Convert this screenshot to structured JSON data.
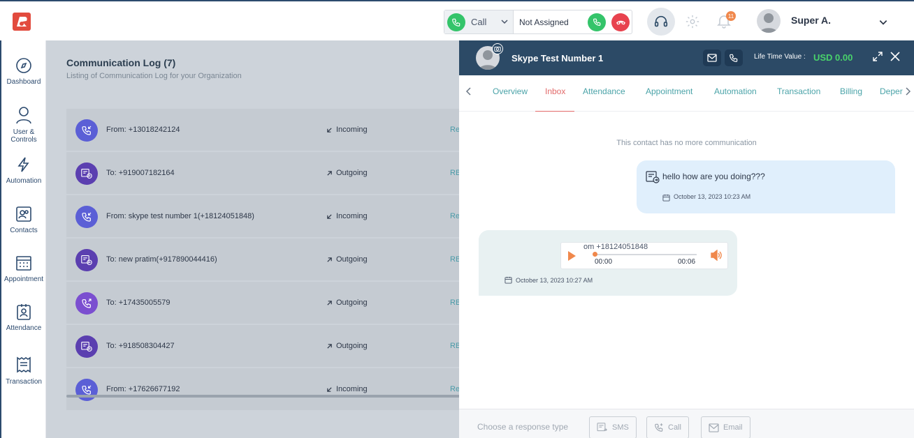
{
  "topbar": {
    "call_select": "Call",
    "agent_status": "Not Assigned",
    "notifications_count": "11",
    "user_name": "Super A."
  },
  "sidebar": {
    "items": [
      {
        "label": "Dashboard",
        "icon": "compass-icon"
      },
      {
        "label": "User &",
        "label2": "Controls",
        "icon": "user-icon"
      },
      {
        "label": "Automation",
        "icon": "lightning-icon"
      },
      {
        "label": "Contacts",
        "icon": "contacts-icon"
      },
      {
        "label": "Appointment",
        "icon": "calendar-grid-icon"
      },
      {
        "label": "Attendance",
        "icon": "badge-icon"
      },
      {
        "label": "Transaction",
        "icon": "receipt-icon"
      }
    ]
  },
  "main": {
    "title": "Communication Log  (7)",
    "subtitle": "Listing of Communication Log for your Organization",
    "rows": [
      {
        "who": "From: +13018242124",
        "direction": "Incoming",
        "tag": "Re",
        "kind": "call-in"
      },
      {
        "who": "To: +919007182164",
        "direction": "Outgoing",
        "tag": "RB",
        "kind": "sms"
      },
      {
        "who": "From: skype test number 1(+18124051848)",
        "direction": "Incoming",
        "tag": "Re",
        "kind": "call-in"
      },
      {
        "who": "To: new pratim(+917890044416)",
        "direction": "Outgoing",
        "tag": "RB",
        "kind": "sms"
      },
      {
        "who": "To: +17435005579",
        "direction": "Outgoing",
        "tag": "RB",
        "kind": "call-out"
      },
      {
        "who": "To: +918508304427",
        "direction": "Outgoing",
        "tag": "RB",
        "kind": "sms"
      },
      {
        "who": "From: +17626677192",
        "direction": "Incoming",
        "tag": "Re",
        "kind": "call-in"
      }
    ]
  },
  "panel": {
    "contact_name": "Skype Test Number 1",
    "ltv_label": "Life Time Value :",
    "ltv_value": "USD 0.00",
    "tabs": [
      "Overview",
      "Inbox",
      "Attendance",
      "Appointment",
      "Automation",
      "Transaction",
      "Billing",
      "Deper"
    ],
    "active_tab": "Inbox",
    "no_more": "This contact has no more communication",
    "outgoing_message": {
      "text": "hello how are you doing???",
      "date": "October 13, 2023 10:23 AM"
    },
    "incoming_audio": {
      "filename": "om +18124051848",
      "current": "00:00",
      "duration": "00:06",
      "progress": 0.0,
      "date": "October 13, 2023 10:27 AM"
    },
    "response_label": "Choose a response type",
    "response_buttons": {
      "sms": "SMS",
      "call": "Call",
      "email": "Email"
    }
  },
  "colors": {
    "brand_navy": "#2c4a66",
    "accent_teal": "#4aa3a8",
    "active_tab": "#e26a6a",
    "ltv_green": "#49d36b",
    "call_green": "#34c46a",
    "hangup_red": "#e8434f",
    "badge_orange": "#f0884c",
    "icon_purple": "#5b3fb0"
  }
}
